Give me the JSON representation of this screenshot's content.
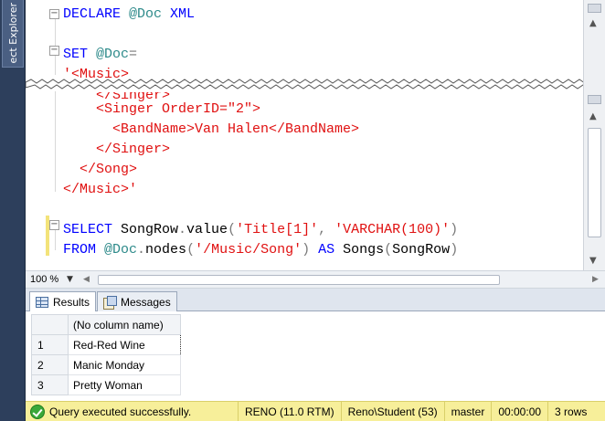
{
  "side_panel": {
    "tab_label": "ect Explorer"
  },
  "editor": {
    "lines_top": [
      {
        "parts": [
          {
            "t": "DECLARE ",
            "c": "kw"
          },
          {
            "t": "@Doc",
            "c": "var"
          },
          {
            "t": " ",
            "c": "plain"
          },
          {
            "t": "XML",
            "c": "kw"
          }
        ]
      },
      {
        "parts": []
      },
      {
        "parts": [
          {
            "t": "SET ",
            "c": "kw"
          },
          {
            "t": "@Doc",
            "c": "var"
          },
          {
            "t": "=",
            "c": "gray"
          }
        ]
      },
      {
        "parts": [
          {
            "t": "'<Music>",
            "c": "str"
          }
        ]
      }
    ],
    "lines_bottom": [
      {
        "parts": [
          {
            "t": "    <Singer OrderID=\"2\">",
            "c": "str"
          }
        ]
      },
      {
        "parts": [
          {
            "t": "      <BandName>Van Halen</BandName>",
            "c": "str"
          }
        ]
      },
      {
        "parts": [
          {
            "t": "    </Singer>",
            "c": "str"
          }
        ]
      },
      {
        "parts": [
          {
            "t": "  </Song>",
            "c": "str"
          }
        ]
      },
      {
        "parts": [
          {
            "t": "</Music>'",
            "c": "str"
          }
        ]
      },
      {
        "parts": []
      },
      {
        "parts": [
          {
            "t": "SELECT ",
            "c": "kw"
          },
          {
            "t": "SongRow",
            "c": "plain"
          },
          {
            "t": ".",
            "c": "gray"
          },
          {
            "t": "value",
            "c": "plain"
          },
          {
            "t": "(",
            "c": "gray"
          },
          {
            "t": "'Title[1]'",
            "c": "str"
          },
          {
            "t": ", ",
            "c": "gray"
          },
          {
            "t": "'VARCHAR(100)'",
            "c": "str"
          },
          {
            "t": ")",
            "c": "gray"
          }
        ]
      },
      {
        "parts": [
          {
            "t": "FROM ",
            "c": "kw"
          },
          {
            "t": "@Doc",
            "c": "var"
          },
          {
            "t": ".",
            "c": "gray"
          },
          {
            "t": "nodes",
            "c": "plain"
          },
          {
            "t": "(",
            "c": "gray"
          },
          {
            "t": "'/Music/Song'",
            "c": "str"
          },
          {
            "t": ") ",
            "c": "gray"
          },
          {
            "t": "AS ",
            "c": "kw"
          },
          {
            "t": "Songs",
            "c": "plain"
          },
          {
            "t": "(",
            "c": "gray"
          },
          {
            "t": "SongRow",
            "c": "plain"
          },
          {
            "t": ")",
            "c": "gray"
          }
        ]
      }
    ],
    "torn_fragment": "    </Singer>"
  },
  "zoom": {
    "value": "100 %"
  },
  "tabs": [
    {
      "label": "Results",
      "active": true
    },
    {
      "label": "Messages",
      "active": false
    }
  ],
  "results": {
    "columns": [
      "(No column name)"
    ],
    "rows": [
      {
        "num": "1",
        "value": "Red-Red Wine"
      },
      {
        "num": "2",
        "value": "Manic Monday"
      },
      {
        "num": "3",
        "value": "Pretty Woman"
      }
    ]
  },
  "status": {
    "message": "Query executed successfully.",
    "server": "RENO (11.0 RTM)",
    "user": "Reno\\Student (53)",
    "database": "master",
    "elapsed": "00:00:00",
    "rows": "3 rows"
  },
  "colors": {
    "keyword": "#0000ff",
    "variable": "#2d8a8a",
    "string": "#e01010",
    "status_bar": "#f7ef9a"
  }
}
